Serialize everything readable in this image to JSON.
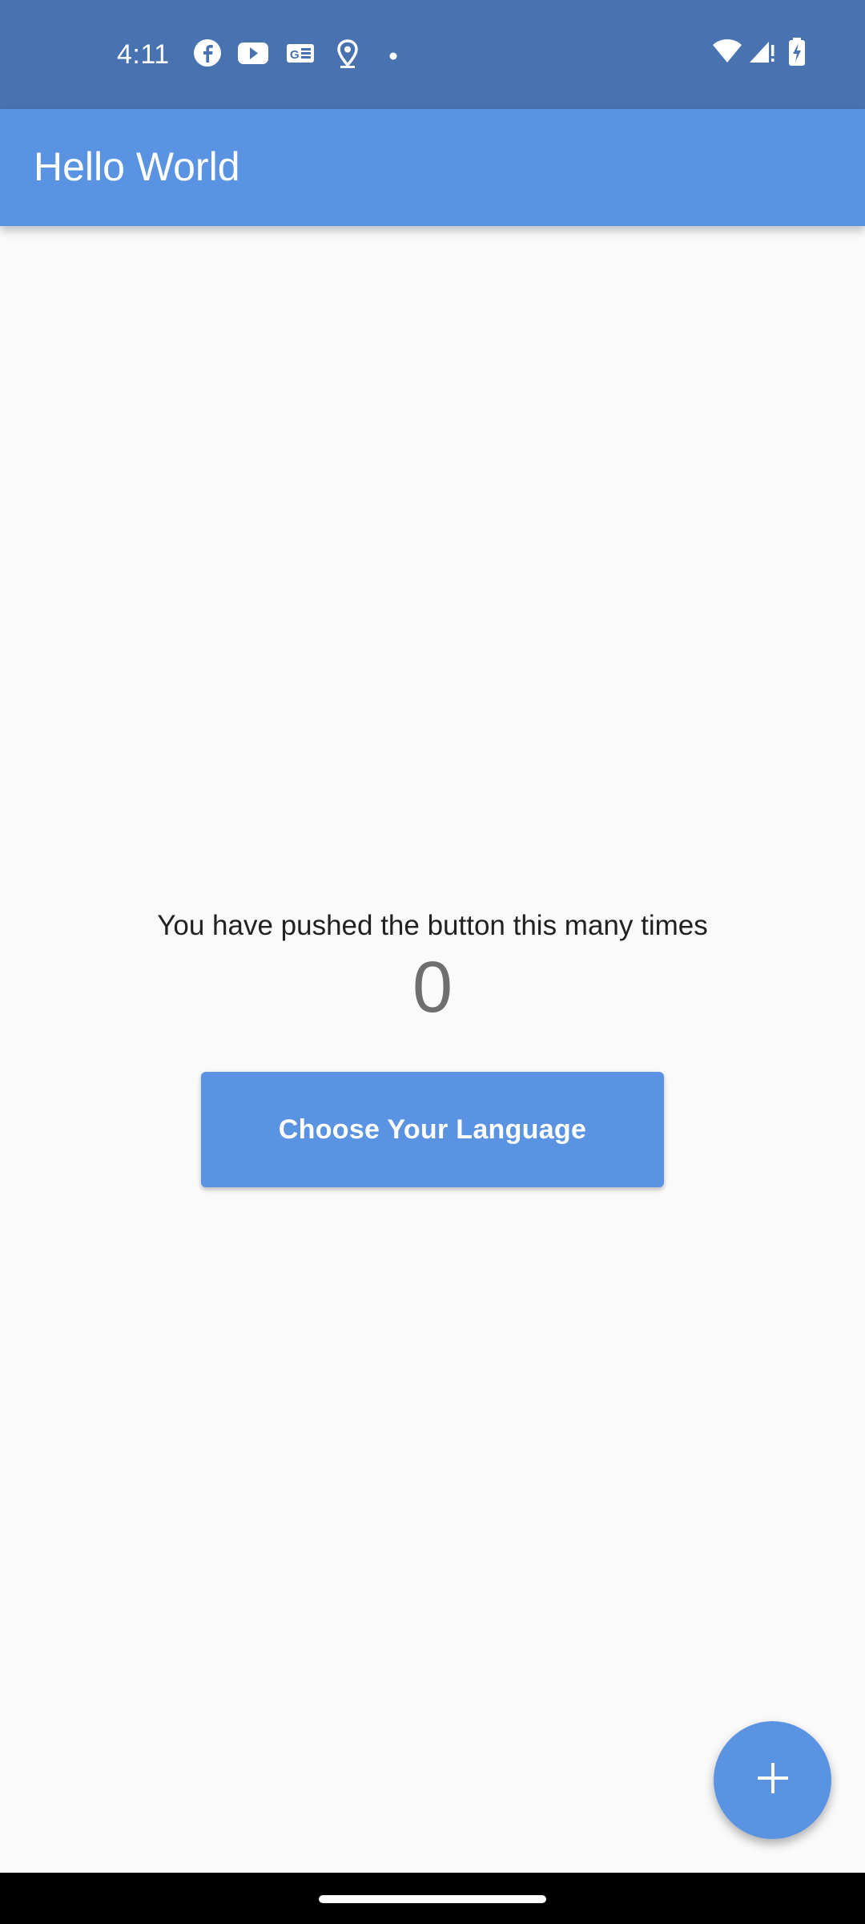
{
  "status_bar": {
    "time": "4:11",
    "notification_icons": [
      "facebook-icon",
      "youtube-icon",
      "news-icon",
      "location-icon",
      "dot-icon"
    ],
    "system_icons": [
      "wifi-icon",
      "signal-icon",
      "battery-charging-icon"
    ]
  },
  "app_bar": {
    "title": "Hello World"
  },
  "main": {
    "counter_label": "You have pushed the button this many times",
    "counter_value": "0",
    "language_button_label": "Choose Your Language"
  },
  "fab": {
    "icon": "add-icon"
  },
  "colors": {
    "primary": "#5b93e3",
    "status_bar": "#4872b0",
    "background": "#fafafa"
  }
}
